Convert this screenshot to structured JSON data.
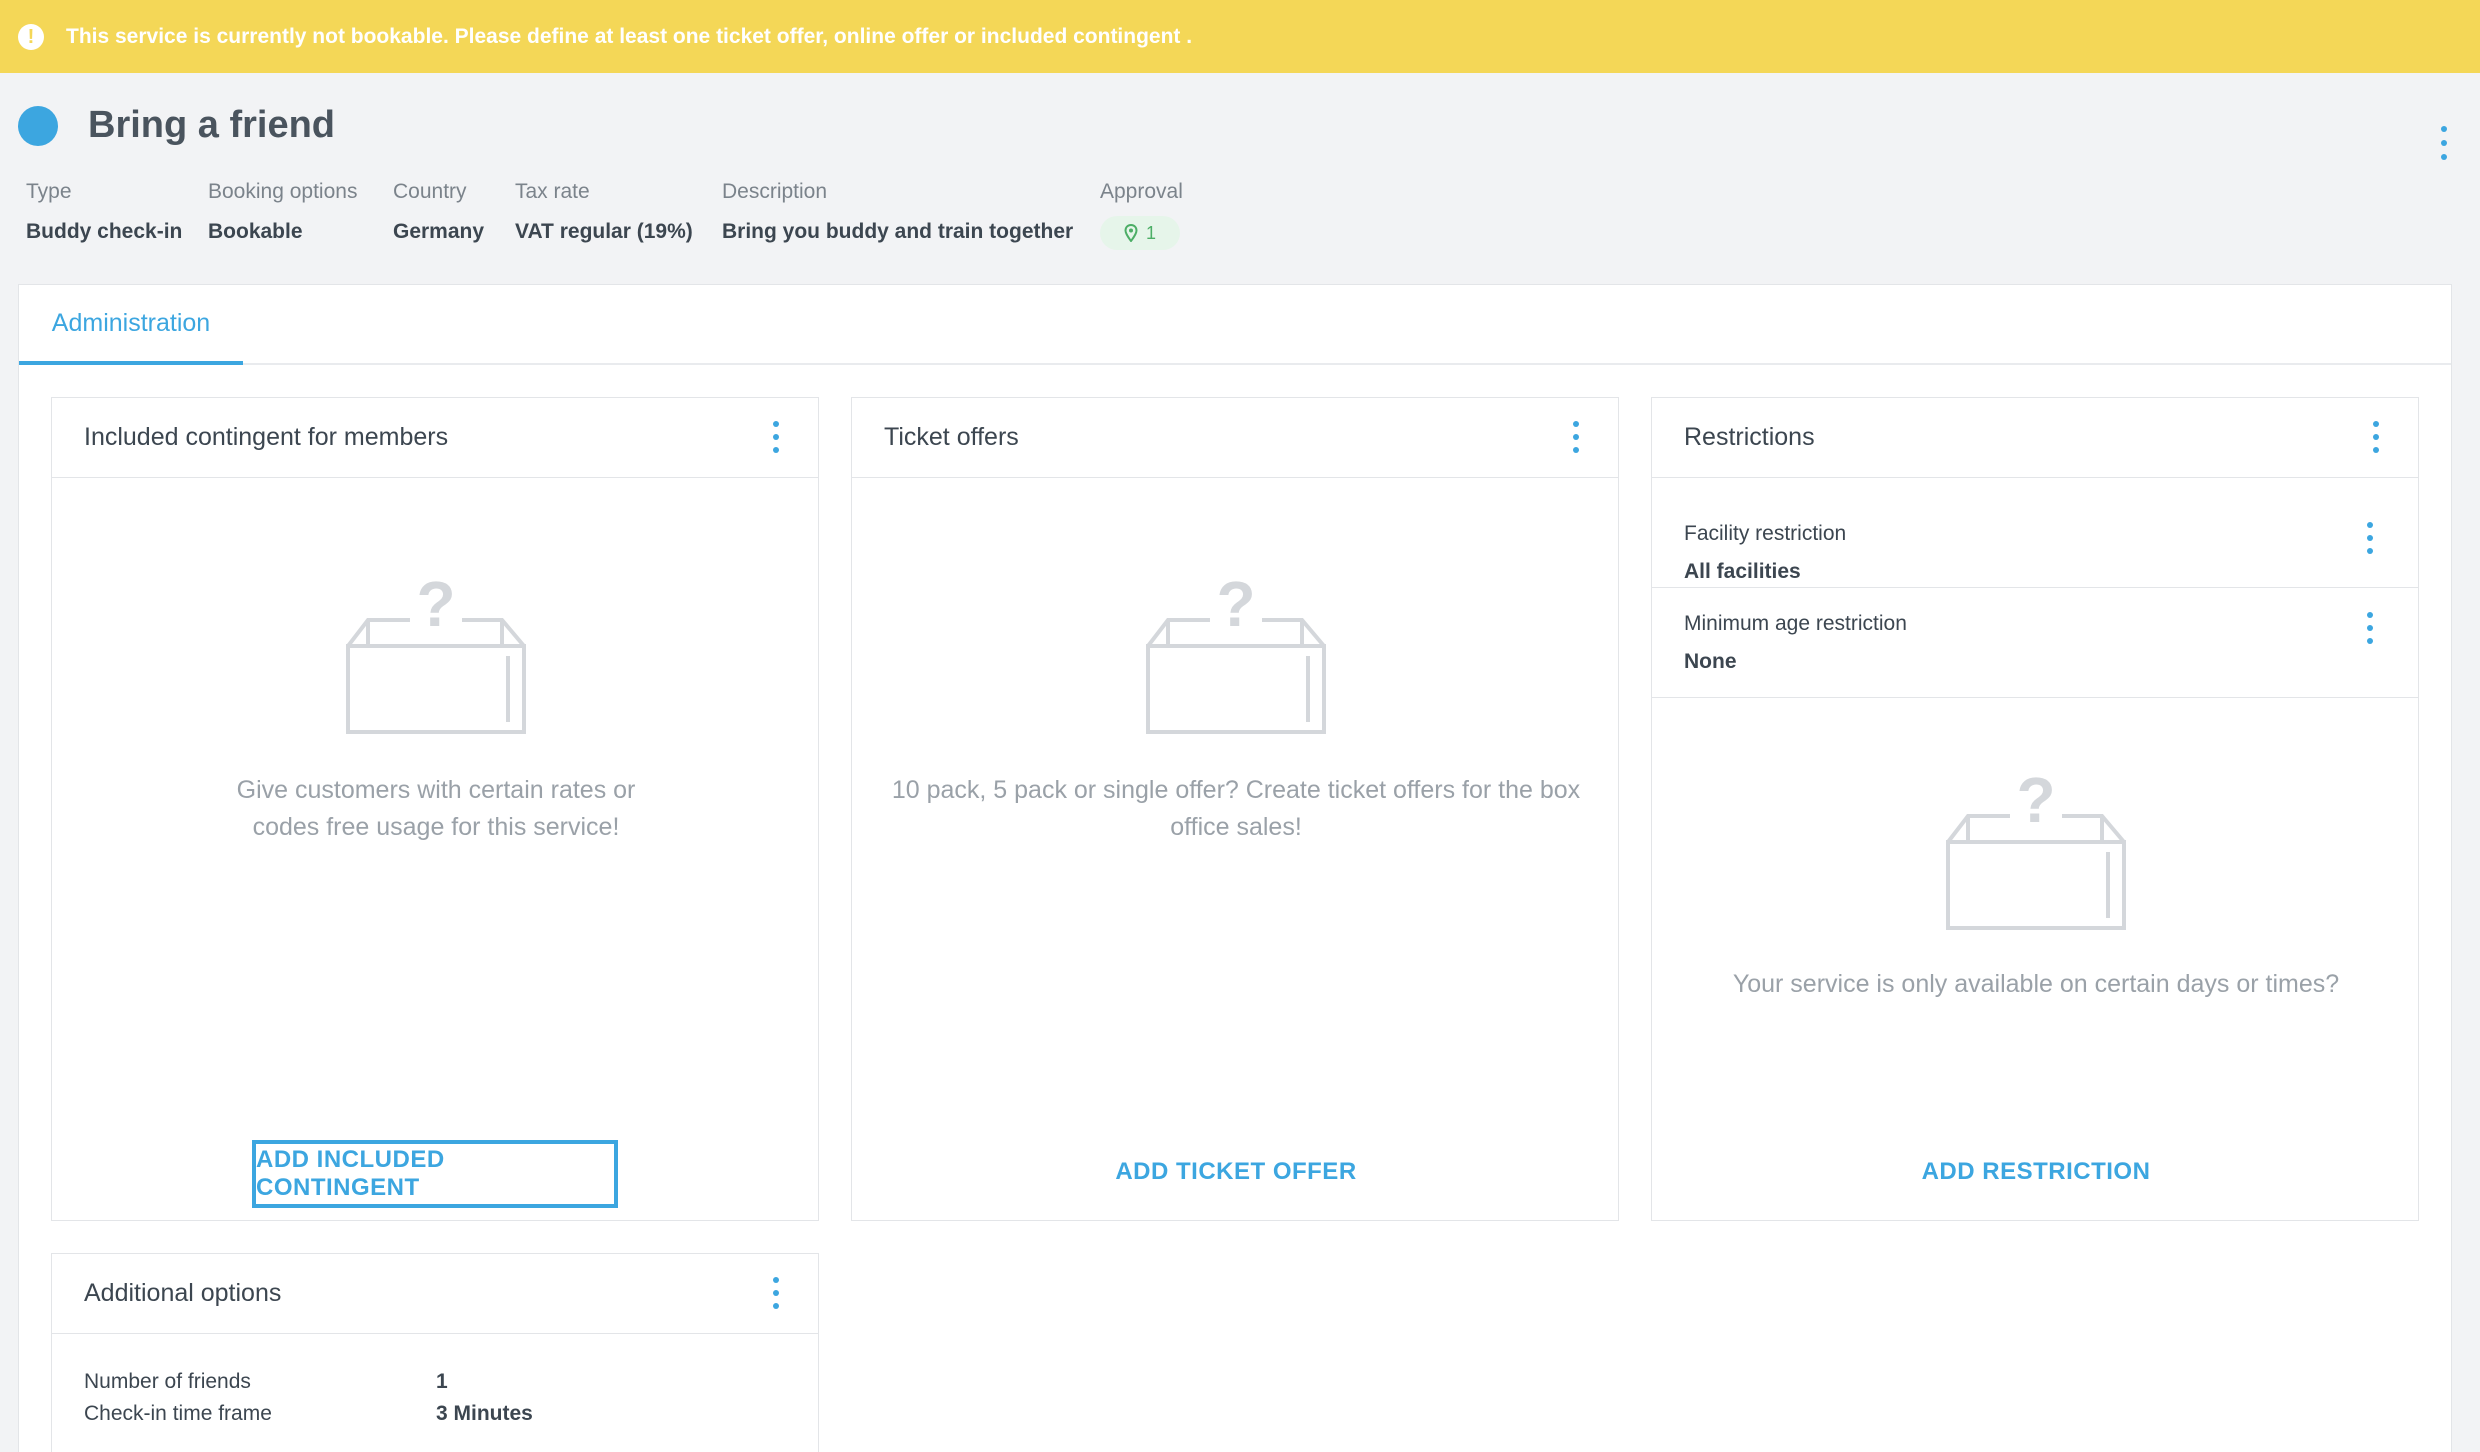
{
  "banner": {
    "icon": "exclamation-icon",
    "message": "This service is currently not bookable. Please define at least one ticket offer, online offer or included contingent ."
  },
  "header": {
    "title": "Bring a friend",
    "status_color": "#3ca6e0"
  },
  "meta": [
    {
      "label": "Type",
      "value": "Buddy check-in"
    },
    {
      "label": "Booking options",
      "value": "Bookable"
    },
    {
      "label": "Country",
      "value": "Germany"
    },
    {
      "label": "Tax rate",
      "value": "VAT regular (19%)"
    },
    {
      "label": "Description",
      "value": "Bring you buddy and train together"
    }
  ],
  "approval": {
    "label": "Approval",
    "count": "1"
  },
  "tabs": [
    {
      "label": "Administration",
      "active": true
    }
  ],
  "cards": {
    "contingent": {
      "title": "Included contingent for members",
      "empty_text": "Give customers with certain rates or codes free usage for this service!",
      "button": "ADD INCLUDED CONTINGENT"
    },
    "tickets": {
      "title": "Ticket offers",
      "empty_text": "10 pack, 5 pack or single offer? Create ticket offers for the box office sales!",
      "button": "ADD TICKET OFFER"
    },
    "restrictions": {
      "title": "Restrictions",
      "rows": [
        {
          "label": "Facility restriction",
          "value": "All facilities"
        },
        {
          "label": "Minimum age restriction",
          "value": "None"
        }
      ],
      "empty_text": "Your service is only available on certain days or times?",
      "button": "ADD RESTRICTION"
    },
    "additional": {
      "title": "Additional options",
      "rows": [
        {
          "label": "Number of friends",
          "value": "1"
        },
        {
          "label": "Check-in time frame",
          "value": "3 Minutes"
        }
      ]
    }
  },
  "colors": {
    "accent": "#3ca6e0",
    "warning": "#f4d757",
    "approval": "#4cae66"
  }
}
